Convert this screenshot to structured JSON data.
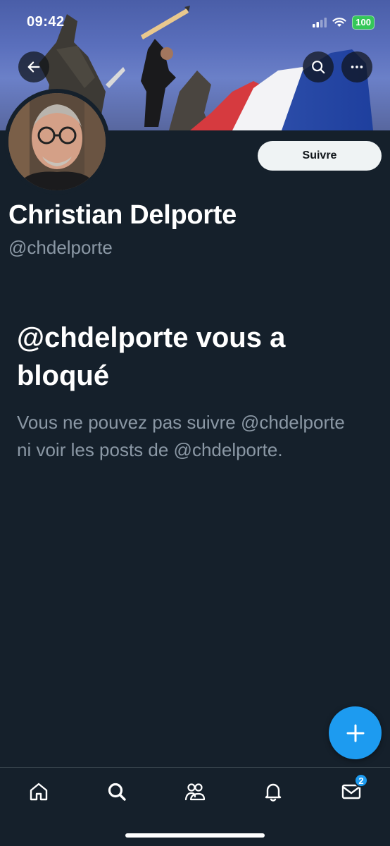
{
  "status_bar": {
    "time": "09:42",
    "battery": "100"
  },
  "profile": {
    "display_name": "Christian Delporte",
    "handle": "@chdelporte",
    "follow_label": "Suivre"
  },
  "blocked": {
    "title": "@chdelporte vous a bloqué",
    "description": "Vous ne pouvez pas suivre @chdelporte ni voir les posts de @chdelporte."
  },
  "nav": {
    "items": [
      {
        "name": "home-icon"
      },
      {
        "name": "search-icon"
      },
      {
        "name": "communities-icon"
      },
      {
        "name": "notifications-icon"
      },
      {
        "name": "messages-icon",
        "badge": "2"
      }
    ]
  },
  "colors": {
    "background": "#15202b",
    "accent": "#1d9bf0",
    "secondary_text": "#8b98a5",
    "follow_button_bg": "#eff3f4"
  }
}
